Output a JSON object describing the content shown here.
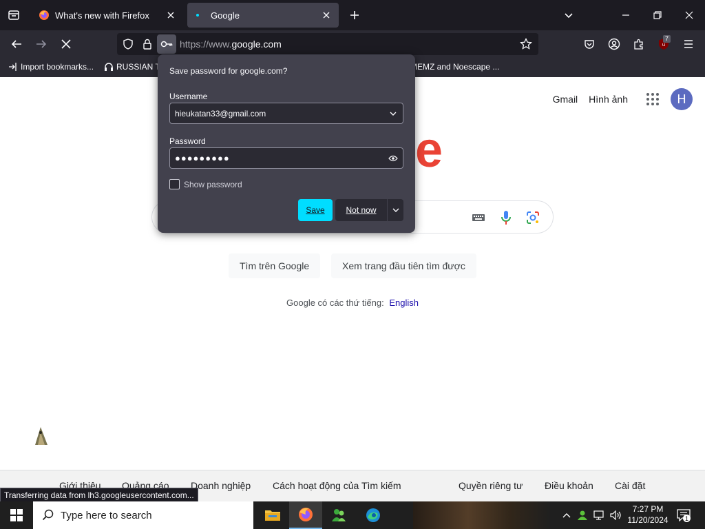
{
  "browser": {
    "tabs": [
      {
        "title": "What's new with Firefox",
        "icon": "firefox-icon"
      },
      {
        "title": "Google",
        "icon": "loading-dot-icon"
      }
    ],
    "url": {
      "prefix": "https://www.",
      "domain": "google.com"
    },
    "extension_badge": "7",
    "bookmarks": [
      {
        "label": "Import bookmarks...",
        "icon": "import-icon"
      },
      {
        "label": "RUSSIAN TI",
        "icon": "headphones-icon"
      },
      {
        "label": "MEMZ and Noescape ...",
        "icon": ""
      }
    ]
  },
  "google": {
    "top_links": [
      "Gmail",
      "Hình ảnh"
    ],
    "avatar_letter": "H",
    "logo_partial": "e",
    "buttons": [
      "Tìm trên Google",
      "Xem trang đầu tiên tìm được"
    ],
    "lang_prefix": "Google có các thứ tiếng:",
    "lang_link": "English",
    "footer_left": [
      "Giới thiệu",
      "Quảng cáo",
      "Doanh nghiệp",
      "Cách hoạt động của Tìm kiếm"
    ],
    "footer_right": [
      "Quyền riêng tư",
      "Điều khoản",
      "Cài đặt"
    ]
  },
  "status_bar": "Transferring data from lh3.googleusercontent.com...",
  "password_popup": {
    "title": "Save password for google.com?",
    "username_label": "Username",
    "username_value": "hieukatan33@gmail.com",
    "password_label": "Password",
    "password_masked": "●●●●●●●●●",
    "show_password_label": "Show password",
    "save_label": "Save",
    "not_now_label": "Not now"
  },
  "taskbar": {
    "search_placeholder": "Type here to search",
    "time": "7:27 PM",
    "date": "11/20/2024",
    "notification_count": "1"
  },
  "colors": {
    "accent": "#00ddff",
    "tab_bar": "#1c1b22",
    "toolbar": "#2b2a33",
    "popup": "#42414d"
  }
}
